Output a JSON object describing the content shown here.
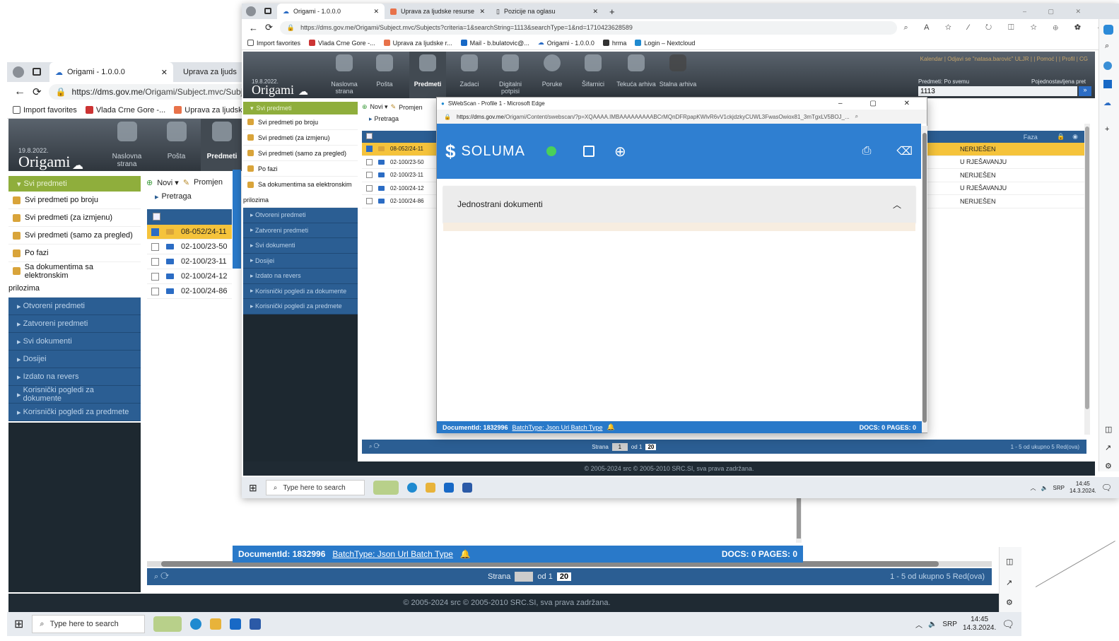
{
  "back": {
    "tabs": [
      {
        "label": "Origami - 1.0.0.0"
      },
      {
        "label": "Uprava za ljudsk"
      }
    ],
    "url_host": "https://dms.gov.me",
    "url_path": "/Origami/Subject.mvc/Subje",
    "favorites": [
      "Import favorites",
      "Vlada Crne Gore -...",
      "Uprava za ljudske r..."
    ],
    "date": "19.8.2022.",
    "app": "Origami",
    "nav": [
      "Naslovna strana",
      "Pošta",
      "Predmeti"
    ],
    "toolbar": {
      "novi": "Novi ▾",
      "promjeni": "Promjen",
      "pretraga": "Pretraga"
    },
    "side_header": "Svi predmeti",
    "side_items": [
      "Svi predmeti po broju",
      "Svi predmeti (za izmjenu)",
      "Svi predmeti (samo za pregled)",
      "Po fazi",
      "Sa dokumentima sa elektronskim",
      "prilozima"
    ],
    "side_sections": [
      "Otvoreni predmeti",
      "Zatvoreni predmeti",
      "Svi dokumenti",
      "Dosijei",
      "Izdato na revers",
      "Korisnički pogledi za dokumente",
      "Korisnički pogledi za predmete"
    ],
    "rows": [
      "08-052/24-11",
      "02-100/23-50",
      "02-100/23-11",
      "02-100/24-12",
      "02-100/24-86"
    ],
    "pager": {
      "strana": "Strana",
      "od": "od 1",
      "per": "20",
      "summary": "1 - 5 od ukupno 5 Red(ova)"
    },
    "footer": "© 2005-2024 src © 2005-2010 SRC.SI, sva prava zadržana.",
    "status": {
      "doc": "DocumentId: 1832996",
      "batch": "BatchType: Json Url Batch Type",
      "docs": "DOCS: 0 PAGES: 0"
    },
    "taskbar": {
      "search": "Type here to search",
      "lang": "SRP",
      "time": "14:45",
      "date": "14.3.2024."
    }
  },
  "front": {
    "tabs": [
      {
        "label": "Origami - 1.0.0.0"
      },
      {
        "label": "Uprava za ljudske resurse"
      },
      {
        "label": "Pozicije na oglasu"
      }
    ],
    "url": "https://dms.gov.me/Origami/Subject.mvc/Subjects?criteria=1&searchString=1113&searchType=1&nd=1710423628589",
    "favorites": [
      "Import favorites",
      "Vlada Crne Gore -...",
      "Uprava za ljudske r...",
      "Mail - b.bulatovic@...",
      "Origami - 1.0.0.0",
      "hrma",
      "Login – Nextcloud"
    ],
    "date": "19.8.2022.",
    "app": "Origami",
    "nav": [
      "Naslovna strana",
      "Pošta",
      "Predmeti",
      "Zadaci",
      "Digitalni potpisi",
      "Poruke",
      "Šifarnici",
      "Tekuća arhiva",
      "Stalna arhiva"
    ],
    "top_links": "Kalendar | Odjavi se \"natasa.barovic\" ULJR | | Pomoć | | Profil | CG",
    "search_label": "Predmeti: Po svemu",
    "search_value": "1113",
    "search_right": "Pojednostavljena pret",
    "toolbar": {
      "novi": "Novi ▾",
      "promjeni": "Promjen",
      "pretraga": "Pretraga"
    },
    "side_header": "Svi predmeti",
    "side_items": [
      "Svi predmeti po broju",
      "Svi predmeti (za izmjenu)",
      "Svi predmeti (samo za pregled)",
      "Po fazi",
      "Sa dokumentima sa elektronskim",
      "prilozima"
    ],
    "side_sections": [
      "Otvoreni predmeti",
      "Zatvoreni predmeti",
      "Svi dokumenti",
      "Dosijei",
      "Izdato na revers",
      "Korisnički pogledi za dokumente",
      "Korisnički pogledi za predmete"
    ],
    "rows": [
      "08-052/24-11",
      "02-100/23-50",
      "02-100/23-11",
      "02-100/24-12",
      "02-100/24-86"
    ],
    "faza_header": "Faza",
    "faza": [
      "NERIJEŠEN",
      "U RJEŠAVANJU",
      "NERIJEŠEN",
      "U RJEŠAVANJU",
      "NERIJEŠEN"
    ],
    "pager": {
      "strana": "Strana",
      "page": "1",
      "od": "od 1",
      "per": "20",
      "summary": "1 - 5 od ukupno 5 Red(ova)"
    },
    "footer": "© 2005-2024 src © 2005-2010 SRC.SI, sva prava zadržana.",
    "taskbar": {
      "search": "Type here to search",
      "lang": "SRP",
      "time": "14:45",
      "date": "14.3.2024."
    }
  },
  "popup": {
    "title": "SWebScan - Profile 1 - Microsoft Edge",
    "url_host": "https://dms.gov.me",
    "url_path": "/Origami/Content/swebscan/?p=XQAAAA.IMBAAAAAAAAABCrMQnDFRpapKWlvR6vV1ckjdzkyCUWL3FwasOwiox81_3mTgxLV5BOJ_...",
    "brand": "SOLUMA",
    "section": "Jednostrani dokumenti",
    "status": {
      "doc": "DocumentId: 1832996",
      "batch": "BatchType: Json Url Batch Type",
      "docs": "DOCS: 0 PAGES: 0"
    }
  },
  "colors": {
    "accent": "#2f7fd1",
    "green": "#8fae3c",
    "selected": "#f5c33b",
    "navy": "#2b5e93"
  }
}
